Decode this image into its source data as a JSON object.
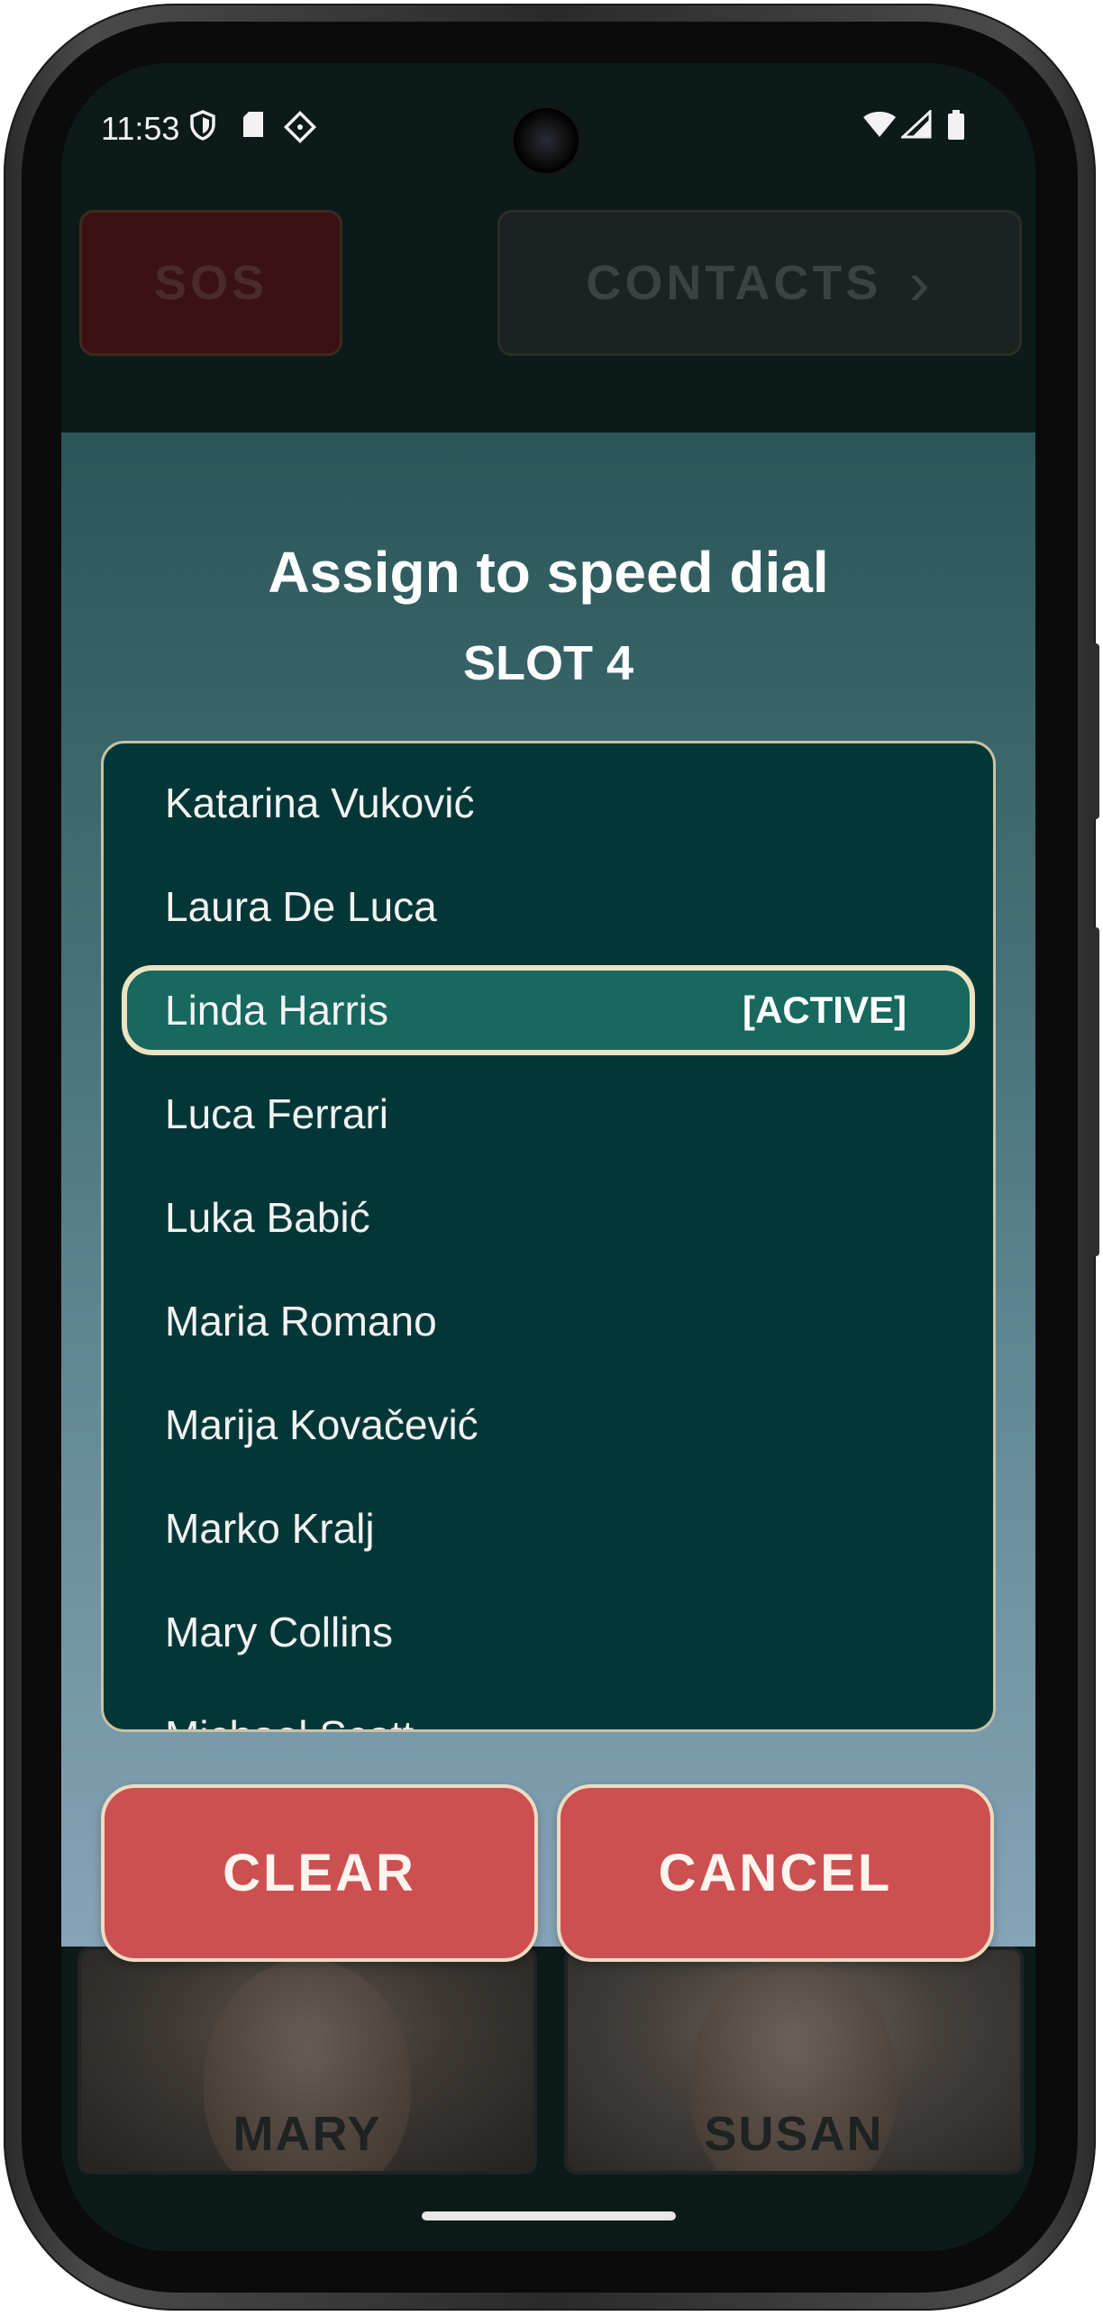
{
  "status_bar": {
    "time": "11:53",
    "left_icons": [
      "shield-icon",
      "sd-card-icon",
      "vpn-icon"
    ],
    "right_icons": [
      "wifi-icon",
      "signal-icon",
      "battery-icon"
    ]
  },
  "background_app": {
    "sos_label": "SOS",
    "contacts_label": "CONTACTS",
    "speed_dial_cards": [
      {
        "name": "MARY"
      },
      {
        "name": "SUSAN"
      }
    ]
  },
  "dialog": {
    "title": "Assign to speed dial",
    "subtitle": "SLOT 4",
    "contacts": [
      {
        "name": "Katarina Vuković",
        "tag": ""
      },
      {
        "name": "Laura De Luca",
        "tag": ""
      },
      {
        "name": "Linda Harris",
        "tag": "[ACTIVE]",
        "active": true
      },
      {
        "name": "Luca Ferrari",
        "tag": ""
      },
      {
        "name": "Luka Babić",
        "tag": ""
      },
      {
        "name": "Maria Romano",
        "tag": ""
      },
      {
        "name": "Marija Kovačević",
        "tag": ""
      },
      {
        "name": "Marko Kralj",
        "tag": ""
      },
      {
        "name": "Mary Collins",
        "tag": ""
      },
      {
        "name": "Michael Scott",
        "tag": ""
      }
    ],
    "clear_label": "CLEAR",
    "cancel_label": "CANCEL"
  },
  "colors": {
    "list_background": "#033737",
    "active_item": "#17685f",
    "button": "#cc4f51"
  }
}
